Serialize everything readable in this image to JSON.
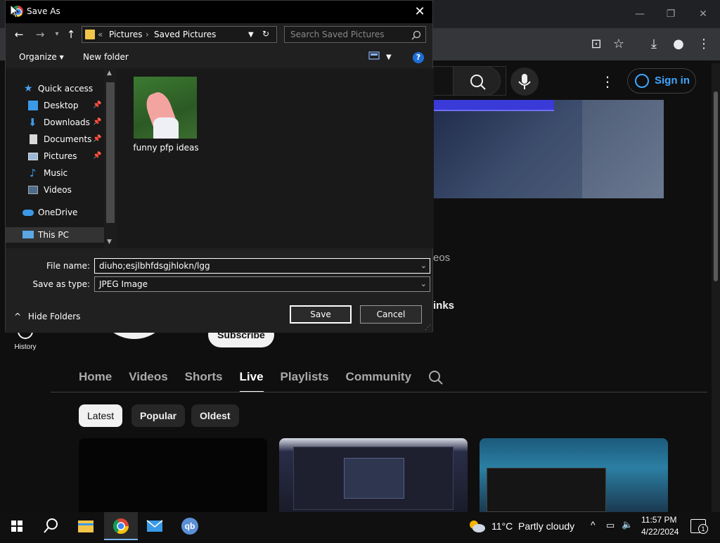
{
  "browser": {
    "youtube": {
      "sign_in": "Sign in",
      "subscribe": "Subscribe",
      "history_label": "History",
      "partial_text_1": "eos",
      "partial_text_2": "inks",
      "tabs": [
        "Home",
        "Videos",
        "Shorts",
        "Live",
        "Playlists",
        "Community"
      ],
      "active_tab": "Live",
      "chips": [
        "Latest",
        "Popular",
        "Oldest"
      ],
      "active_chip": "Latest"
    }
  },
  "dialog": {
    "title": "Save As",
    "path": [
      "Pictures",
      "Saved Pictures"
    ],
    "path_prefix": "«",
    "search_placeholder": "Search Saved Pictures",
    "organize": "Organize ▾",
    "new_folder": "New folder",
    "nav": {
      "quick_access": "Quick access",
      "items": [
        {
          "label": "Desktop",
          "pinned": true
        },
        {
          "label": "Downloads",
          "pinned": true
        },
        {
          "label": "Documents",
          "pinned": true
        },
        {
          "label": "Pictures",
          "pinned": true
        },
        {
          "label": "Music",
          "pinned": false
        },
        {
          "label": "Videos",
          "pinned": false
        }
      ],
      "onedrive": "OneDrive",
      "this_pc": "This PC"
    },
    "files": [
      {
        "name": "funny pfp ideas"
      }
    ],
    "file_name_label": "File name:",
    "file_name_value": "diuho;esjlbhfdsgjhlokn/lgg",
    "save_type_label": "Save as type:",
    "save_type_value": "JPEG Image",
    "hide_folders": "Hide Folders",
    "save_button": "Save",
    "cancel_button": "Cancel"
  },
  "taskbar": {
    "weather_temp": "11°C",
    "weather_desc": "Partly cloudy",
    "time": "11:57 PM",
    "date": "4/22/2024",
    "notification_count": "1",
    "apps": [
      "start",
      "search",
      "file-explorer",
      "chrome",
      "mail",
      "qbittorrent"
    ],
    "qb_label": "qb"
  }
}
